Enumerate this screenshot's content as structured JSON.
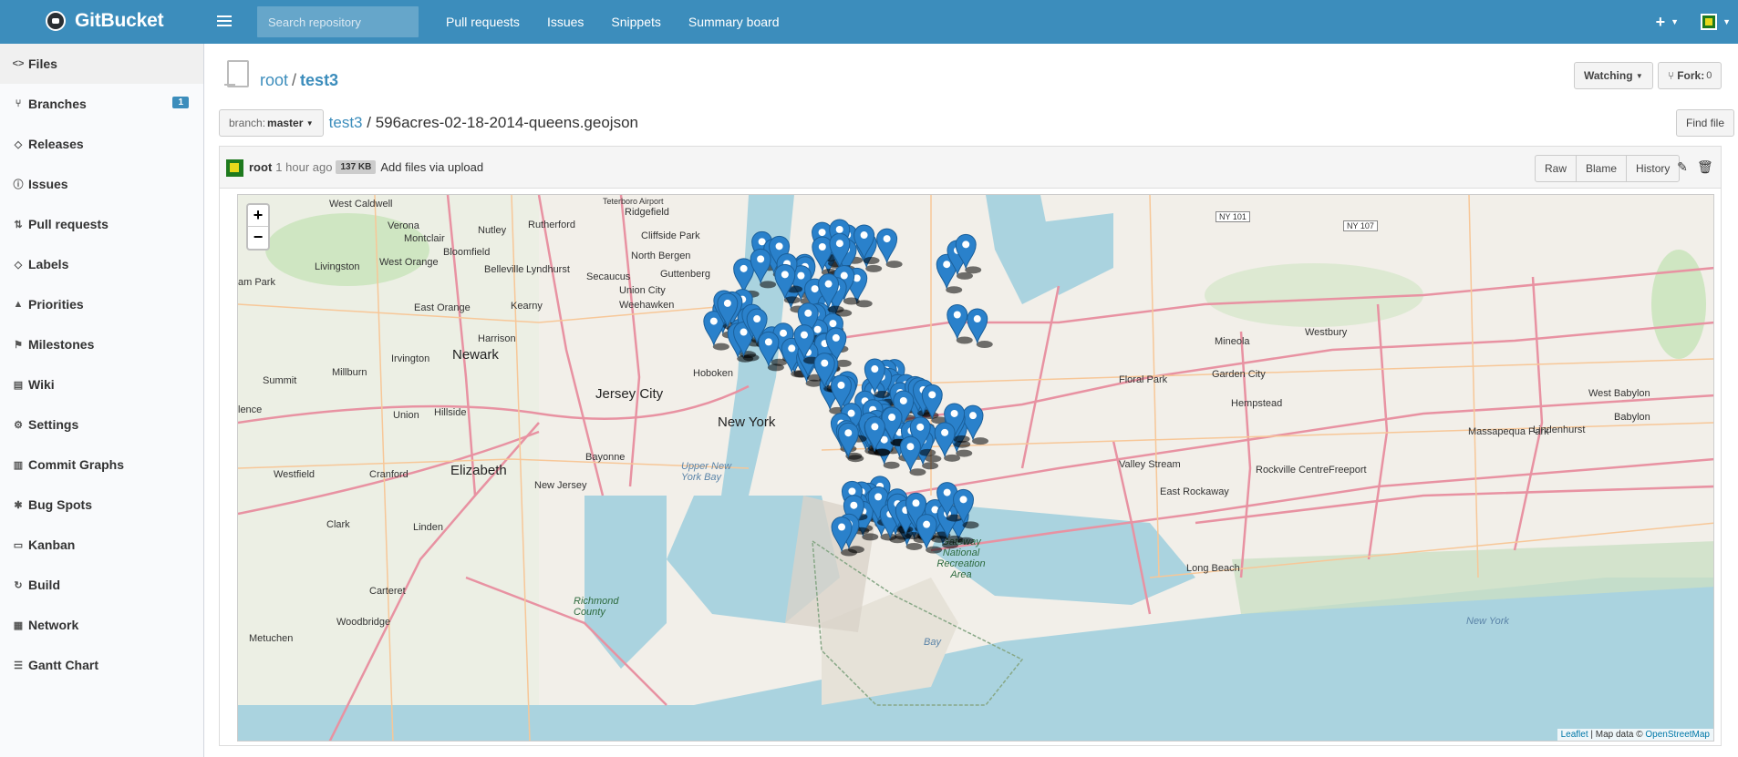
{
  "header": {
    "brand": "GitBucket",
    "search_placeholder": "Search repository",
    "nav": [
      "Pull requests",
      "Issues",
      "Snippets",
      "Summary board"
    ],
    "plus": "+"
  },
  "sidebar": {
    "items": [
      {
        "label": "Files",
        "icon": "code-icon"
      },
      {
        "label": "Branches",
        "icon": "branch-icon",
        "badge": "1"
      },
      {
        "label": "Releases",
        "icon": "tag-icon"
      },
      {
        "label": "Issues",
        "icon": "issue-icon"
      },
      {
        "label": "Pull requests",
        "icon": "pull-request-icon"
      },
      {
        "label": "Labels",
        "icon": "tag-icon"
      },
      {
        "label": "Priorities",
        "icon": "flame-icon"
      },
      {
        "label": "Milestones",
        "icon": "milestone-icon"
      },
      {
        "label": "Wiki",
        "icon": "book-icon"
      },
      {
        "label": "Settings",
        "icon": "gear-icon"
      },
      {
        "label": "Commit Graphs",
        "icon": "graph-icon"
      },
      {
        "label": "Bug Spots",
        "icon": "bug-icon"
      },
      {
        "label": "Kanban",
        "icon": "kanban-icon"
      },
      {
        "label": "Build",
        "icon": "build-icon"
      },
      {
        "label": "Network",
        "icon": "network-icon"
      },
      {
        "label": "Gantt Chart",
        "icon": "gantt-icon"
      }
    ]
  },
  "repo": {
    "owner": "root",
    "separator": "/",
    "name": "test3",
    "watching_label": "Watching",
    "fork_label": "Fork:",
    "fork_count": "0",
    "find_file": "Find file",
    "branch_prefix": "branch:",
    "branch": "master",
    "path_root": "test3",
    "path_sep": "/",
    "file_name": "596acres-02-18-2014-queens.geojson"
  },
  "commit": {
    "author": "root",
    "time": "1 hour ago",
    "size": "137 KB",
    "message": "Add files via upload",
    "buttons": [
      "Raw",
      "Blame",
      "History"
    ]
  },
  "map": {
    "zoom_in": "+",
    "zoom_out": "−",
    "attribution_leaflet": "Leaflet",
    "attribution_text": " | Map data © ",
    "attribution_osm": "OpenStreetMap",
    "place_labels": [
      "West Caldwell",
      "Verona",
      "Montclair",
      "Nutley",
      "Rutherford",
      "Ridgefield",
      "Cliffside Park",
      "North Bergen",
      "Secaucus",
      "Union City",
      "Weehawken",
      "Guttenberg",
      "Livingston",
      "West Orange",
      "Bloomfield",
      "Belleville",
      "Lyndhurst",
      "East Orange",
      "Kearny",
      "Harrison",
      "Newark",
      "Irvington",
      "Millburn",
      "Summit",
      "Hoboken",
      "Jersey City",
      "New York",
      "Union",
      "Hillside",
      "Elizabeth",
      "Bayonne",
      "Westfield",
      "Cranford",
      "Linden",
      "Clark",
      "Carteret",
      "Woodbridge",
      "Metuchen",
      "Floral Park",
      "Mineola",
      "Westbury",
      "Garden City",
      "Hempstead",
      "West Babylon",
      "Babylon",
      "Massapequa Park",
      "Lindenhurst",
      "Rockville Centre",
      "Freeport",
      "Valley Stream",
      "East Rockaway",
      "Long Beach",
      "Teterboro Airport",
      "Upper New York Bay",
      "Gateway National Recreation Area",
      "Richmond County",
      "New Jersey",
      "New York",
      "Bay",
      "am Park",
      "lence"
    ],
    "shields": [
      "NY 101",
      "NY 107"
    ]
  }
}
